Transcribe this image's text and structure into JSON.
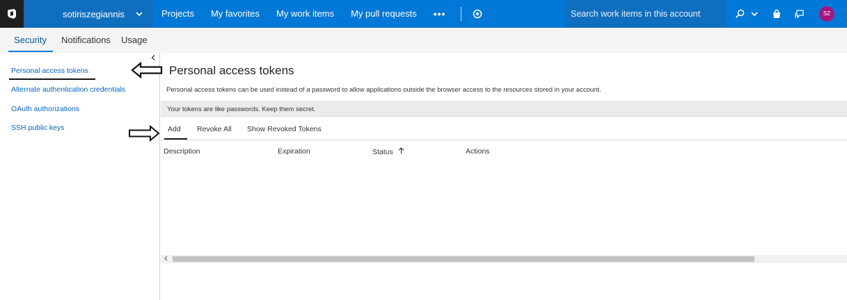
{
  "topbar": {
    "account_name": "sotiriszegiannis",
    "nav_items": [
      "Projects",
      "My favorites",
      "My work items",
      "My pull requests"
    ],
    "more_label": "•••",
    "search_placeholder": "Search work items in this account",
    "avatar_initials": "SZ",
    "brand_color": "#0078d7",
    "avatar_color": "#a4167e"
  },
  "subtabs": [
    "Security",
    "Notifications",
    "Usage"
  ],
  "sidebar": {
    "items": [
      "Personal access tokens",
      "Alternate authentication credentials",
      "OAuth authorizations",
      "SSH public keys"
    ],
    "link_color": "#0064c8"
  },
  "main": {
    "title": "Personal access tokens",
    "description": "Personal access tokens can be used instead of a password to allow applications outside the browser access to the resources stored in your account.",
    "banner": "Your tokens are like passwords. Keep them secret.",
    "toolbar": [
      "Add",
      "Revoke All",
      "Show Revoked Tokens"
    ],
    "columns": [
      "Description",
      "Expiration",
      "Status",
      "Actions"
    ]
  }
}
